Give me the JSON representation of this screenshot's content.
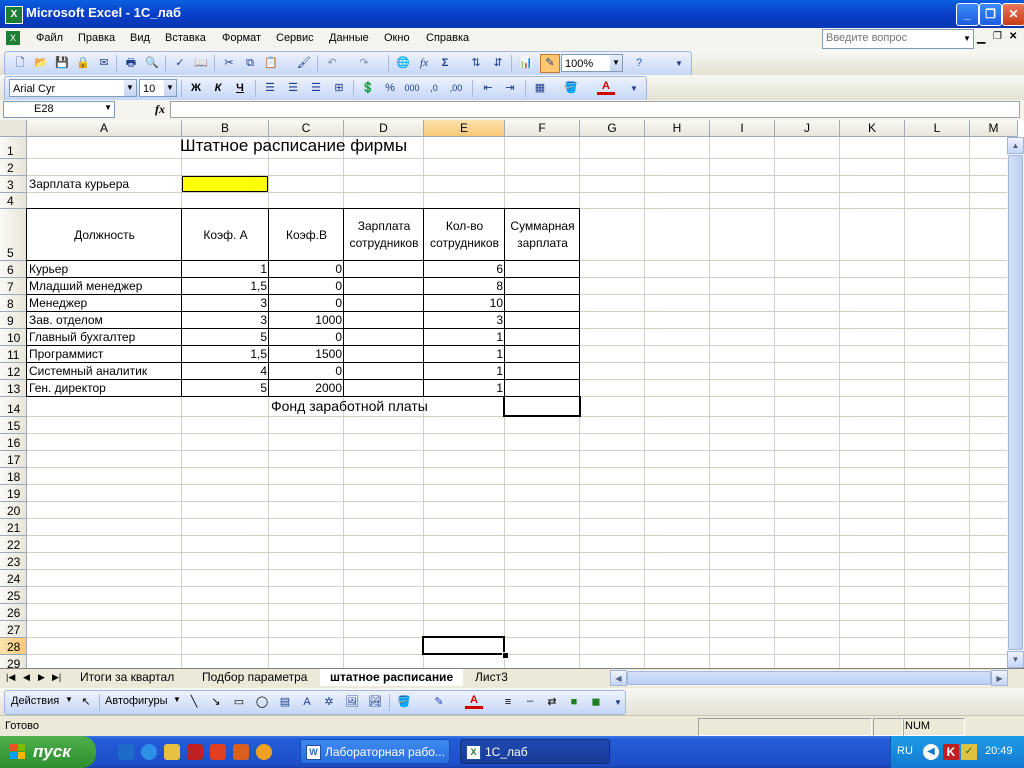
{
  "window": {
    "title": "Microsoft Excel - 1С_лаб",
    "app_icon": "excel-icon"
  },
  "menu": [
    "Файл",
    "Правка",
    "Вид",
    "Вставка",
    "Формат",
    "Сервис",
    "Данные",
    "Окно",
    "Справка"
  ],
  "ask": {
    "placeholder": "Введите вопрос"
  },
  "toolbar": {
    "zoom": "100%"
  },
  "format": {
    "font": "Arial Cyr",
    "size": "10",
    "bold": "Ж",
    "italic": "К",
    "underline": "Ч"
  },
  "formula_bar": {
    "name_box": "E28",
    "fx": "fx",
    "formula": ""
  },
  "columns": [
    "A",
    "B",
    "C",
    "D",
    "E",
    "F",
    "G",
    "H",
    "I",
    "J",
    "K",
    "L",
    "M"
  ],
  "rows": [
    "1",
    "2",
    "3",
    "4",
    "5",
    "6",
    "7",
    "8",
    "9",
    "10",
    "11",
    "12",
    "13",
    "14",
    "15",
    "16",
    "17",
    "18",
    "19",
    "20",
    "21",
    "22",
    "23",
    "24",
    "25",
    "26",
    "27",
    "28",
    "29"
  ],
  "sheet": {
    "title": "Штатное расписание фирмы",
    "courier_label": "Зарплата курьера",
    "headers": {
      "position": "Должность",
      "coef_a": "Коэф. А",
      "coef_b": "Коэф.В",
      "salary_1": "Зарплата",
      "salary_2": "сотрудников",
      "count_1": "Кол-во",
      "count_2": "сотрудников",
      "total_1": "Суммарная",
      "total_2": "зарплата"
    },
    "staff": [
      {
        "position": "Курьер",
        "a": "1",
        "b": "0",
        "count": "6"
      },
      {
        "position": "Младший менеджер",
        "a": "1,5",
        "b": "0",
        "count": "8"
      },
      {
        "position": " Менеджер",
        "a": "3",
        "b": "0",
        "count": "10"
      },
      {
        "position": "Зав. отделом",
        "a": "3",
        "b": "1000",
        "count": "3"
      },
      {
        "position": "Главный бухгалтер",
        "a": "5",
        "b": "0",
        "count": "1"
      },
      {
        "position": "Программист",
        "a": "1,5",
        "b": "1500",
        "count": "1"
      },
      {
        "position": "Системный аналитик",
        "a": "4",
        "b": "0",
        "count": "1"
      },
      {
        "position": "Ген. директор",
        "a": "5",
        "b": "2000",
        "count": "1"
      }
    ],
    "fund_label": "Фонд заработной платы",
    "highlight_color": "#FFFF00"
  },
  "tabs": {
    "tab1": "Итоги за квартал",
    "tab2": "Подбор параметра",
    "tab3": "штатное расписание",
    "tab4": "Лист3"
  },
  "drawing": {
    "actions": "Действия",
    "autoshapes": "Автофигуры"
  },
  "status": {
    "ready": "Готово",
    "num": "NUM"
  },
  "taskbar": {
    "start": "пуск",
    "task1": "Лабораторная рабо...",
    "task2": "1С_лаб",
    "lang": "RU",
    "clock": "20:49"
  }
}
